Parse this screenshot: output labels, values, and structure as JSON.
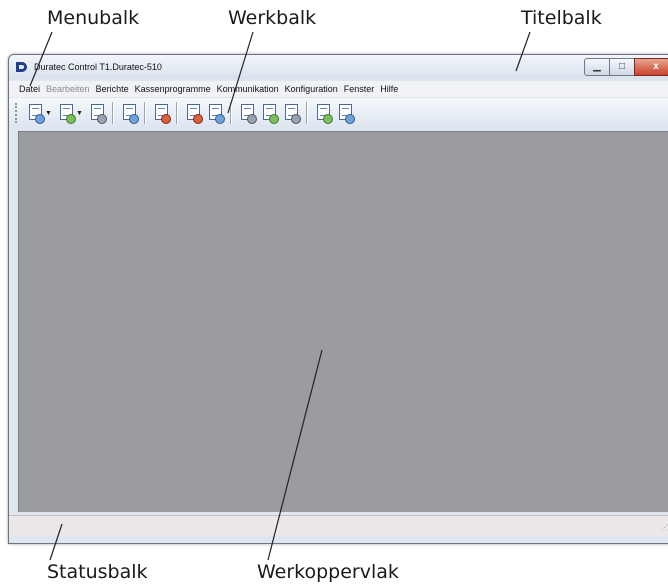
{
  "callouts": {
    "menubalk": "Menubalk",
    "werkbalk": "Werkbalk",
    "titelbalk": "Titelbalk",
    "statusbalk": "Statusbalk",
    "werkoppervlak": "Werkoppervlak"
  },
  "window": {
    "title": "Duratec Control T1.Duratec-510",
    "logo_icon": "duratec-d-logo-icon",
    "logo_color": "#1f3f8a",
    "controls": [
      {
        "name": "minimize",
        "glyph": "▁"
      },
      {
        "name": "maximize",
        "glyph": "□"
      },
      {
        "name": "close",
        "glyph": "x"
      }
    ],
    "close_color": "#c9432b"
  },
  "menubar": {
    "items": [
      {
        "label": "Datei",
        "enabled": true
      },
      {
        "label": "Bearbeiten",
        "enabled": false
      },
      {
        "label": "Berichte",
        "enabled": true
      },
      {
        "label": "Kassenprogramme",
        "enabled": true
      },
      {
        "label": "Kommunikation",
        "enabled": true
      },
      {
        "label": "Konfiguration",
        "enabled": true
      },
      {
        "label": "Fenster",
        "enabled": true
      },
      {
        "label": "Hilfe",
        "enabled": true
      }
    ]
  },
  "toolbar": {
    "groups": [
      [
        {
          "icon": "new-document-icon",
          "dropdown": true
        },
        {
          "icon": "open-document-icon",
          "dropdown": true
        },
        {
          "icon": "print-layout-icon",
          "dropdown": false
        }
      ],
      [
        {
          "icon": "register-connect-icon",
          "dropdown": false
        }
      ],
      [
        {
          "icon": "edit-document-icon",
          "dropdown": false
        }
      ],
      [
        {
          "icon": "send-to-register-icon",
          "dropdown": false
        },
        {
          "icon": "receive-from-register-icon",
          "dropdown": false
        }
      ],
      [
        {
          "icon": "report-list-icon",
          "dropdown": false
        },
        {
          "icon": "configure-icon",
          "dropdown": false
        },
        {
          "icon": "settings-gear-icon",
          "dropdown": false
        }
      ],
      [
        {
          "icon": "print-icon",
          "dropdown": false
        },
        {
          "icon": "print-transfer-icon",
          "dropdown": false
        }
      ]
    ]
  },
  "workspace": {
    "background": "#9a9ca0"
  },
  "statusbar": {
    "text": ""
  }
}
